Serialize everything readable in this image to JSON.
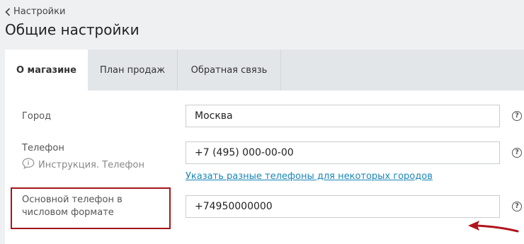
{
  "breadcrumb": {
    "label": "Настройки",
    "icon": "chevron-left-icon"
  },
  "page": {
    "title": "Общие настройки"
  },
  "tabs": [
    {
      "label": "О магазине",
      "active": true
    },
    {
      "label": "План продаж",
      "active": false
    },
    {
      "label": "Обратная связь",
      "active": false
    }
  ],
  "form": {
    "city": {
      "label": "Город",
      "value": "Москва"
    },
    "phone": {
      "label": "Телефон",
      "hint": "Инструкция. Телефон",
      "value": "+7 (495) 000-00-00",
      "link": "Указать разные телефоны для некоторых городов"
    },
    "numeric_phone": {
      "label": "Основной телефон в числовом формате",
      "value": "+74950000000"
    },
    "help_symbol": "?"
  },
  "colors": {
    "highlight": "#a3161b",
    "link": "#1a86b8",
    "arrow": "#b0141a"
  }
}
